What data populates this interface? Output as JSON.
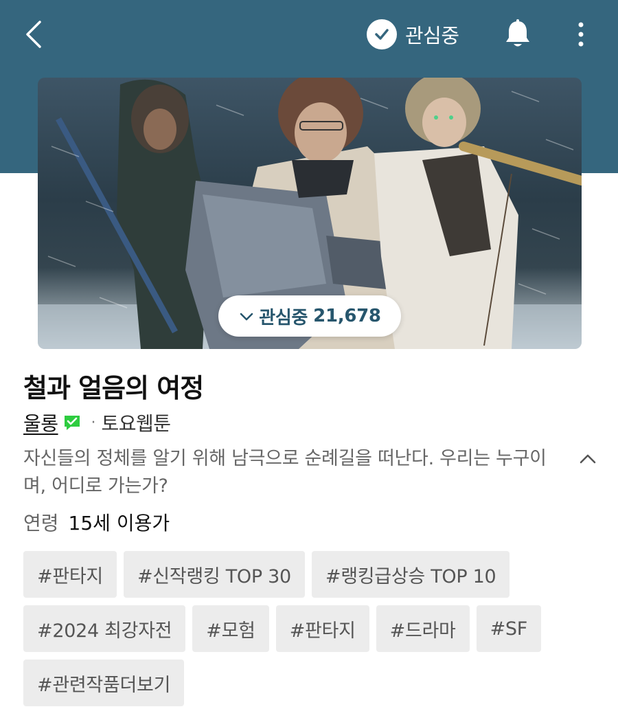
{
  "header": {
    "subscribe_label": "관심중",
    "colors": {
      "band": "#35667e"
    }
  },
  "cover": {
    "subscribe_pill_label": "관심중",
    "subscriber_count": "21,678"
  },
  "title": "철과 얼음의 여정",
  "meta": {
    "author": "울롱",
    "separator": "·",
    "day": "토요웹툰"
  },
  "description": "자신들의 정체를 알기 위해 남극으로 순례길을 떠난다. 우리는 누구이며, 어디로 가는가?",
  "age": {
    "label": "연령",
    "value": "15세 이용가"
  },
  "tags": [
    [
      "#판타지",
      "#신작랭킹 TOP 30",
      "#랭킹급상승 TOP 10"
    ],
    [
      "#2024 최강자전",
      "#모험",
      "#판타지",
      "#드라마",
      "#SF"
    ],
    [
      "#관련작품더보기"
    ]
  ],
  "icons": {
    "back": "chevron-left-icon",
    "subscribed": "check-circle-icon",
    "notification": "bell-icon",
    "more": "more-vertical-icon",
    "verified": "verified-badge-icon",
    "collapse": "chevron-up-icon"
  }
}
